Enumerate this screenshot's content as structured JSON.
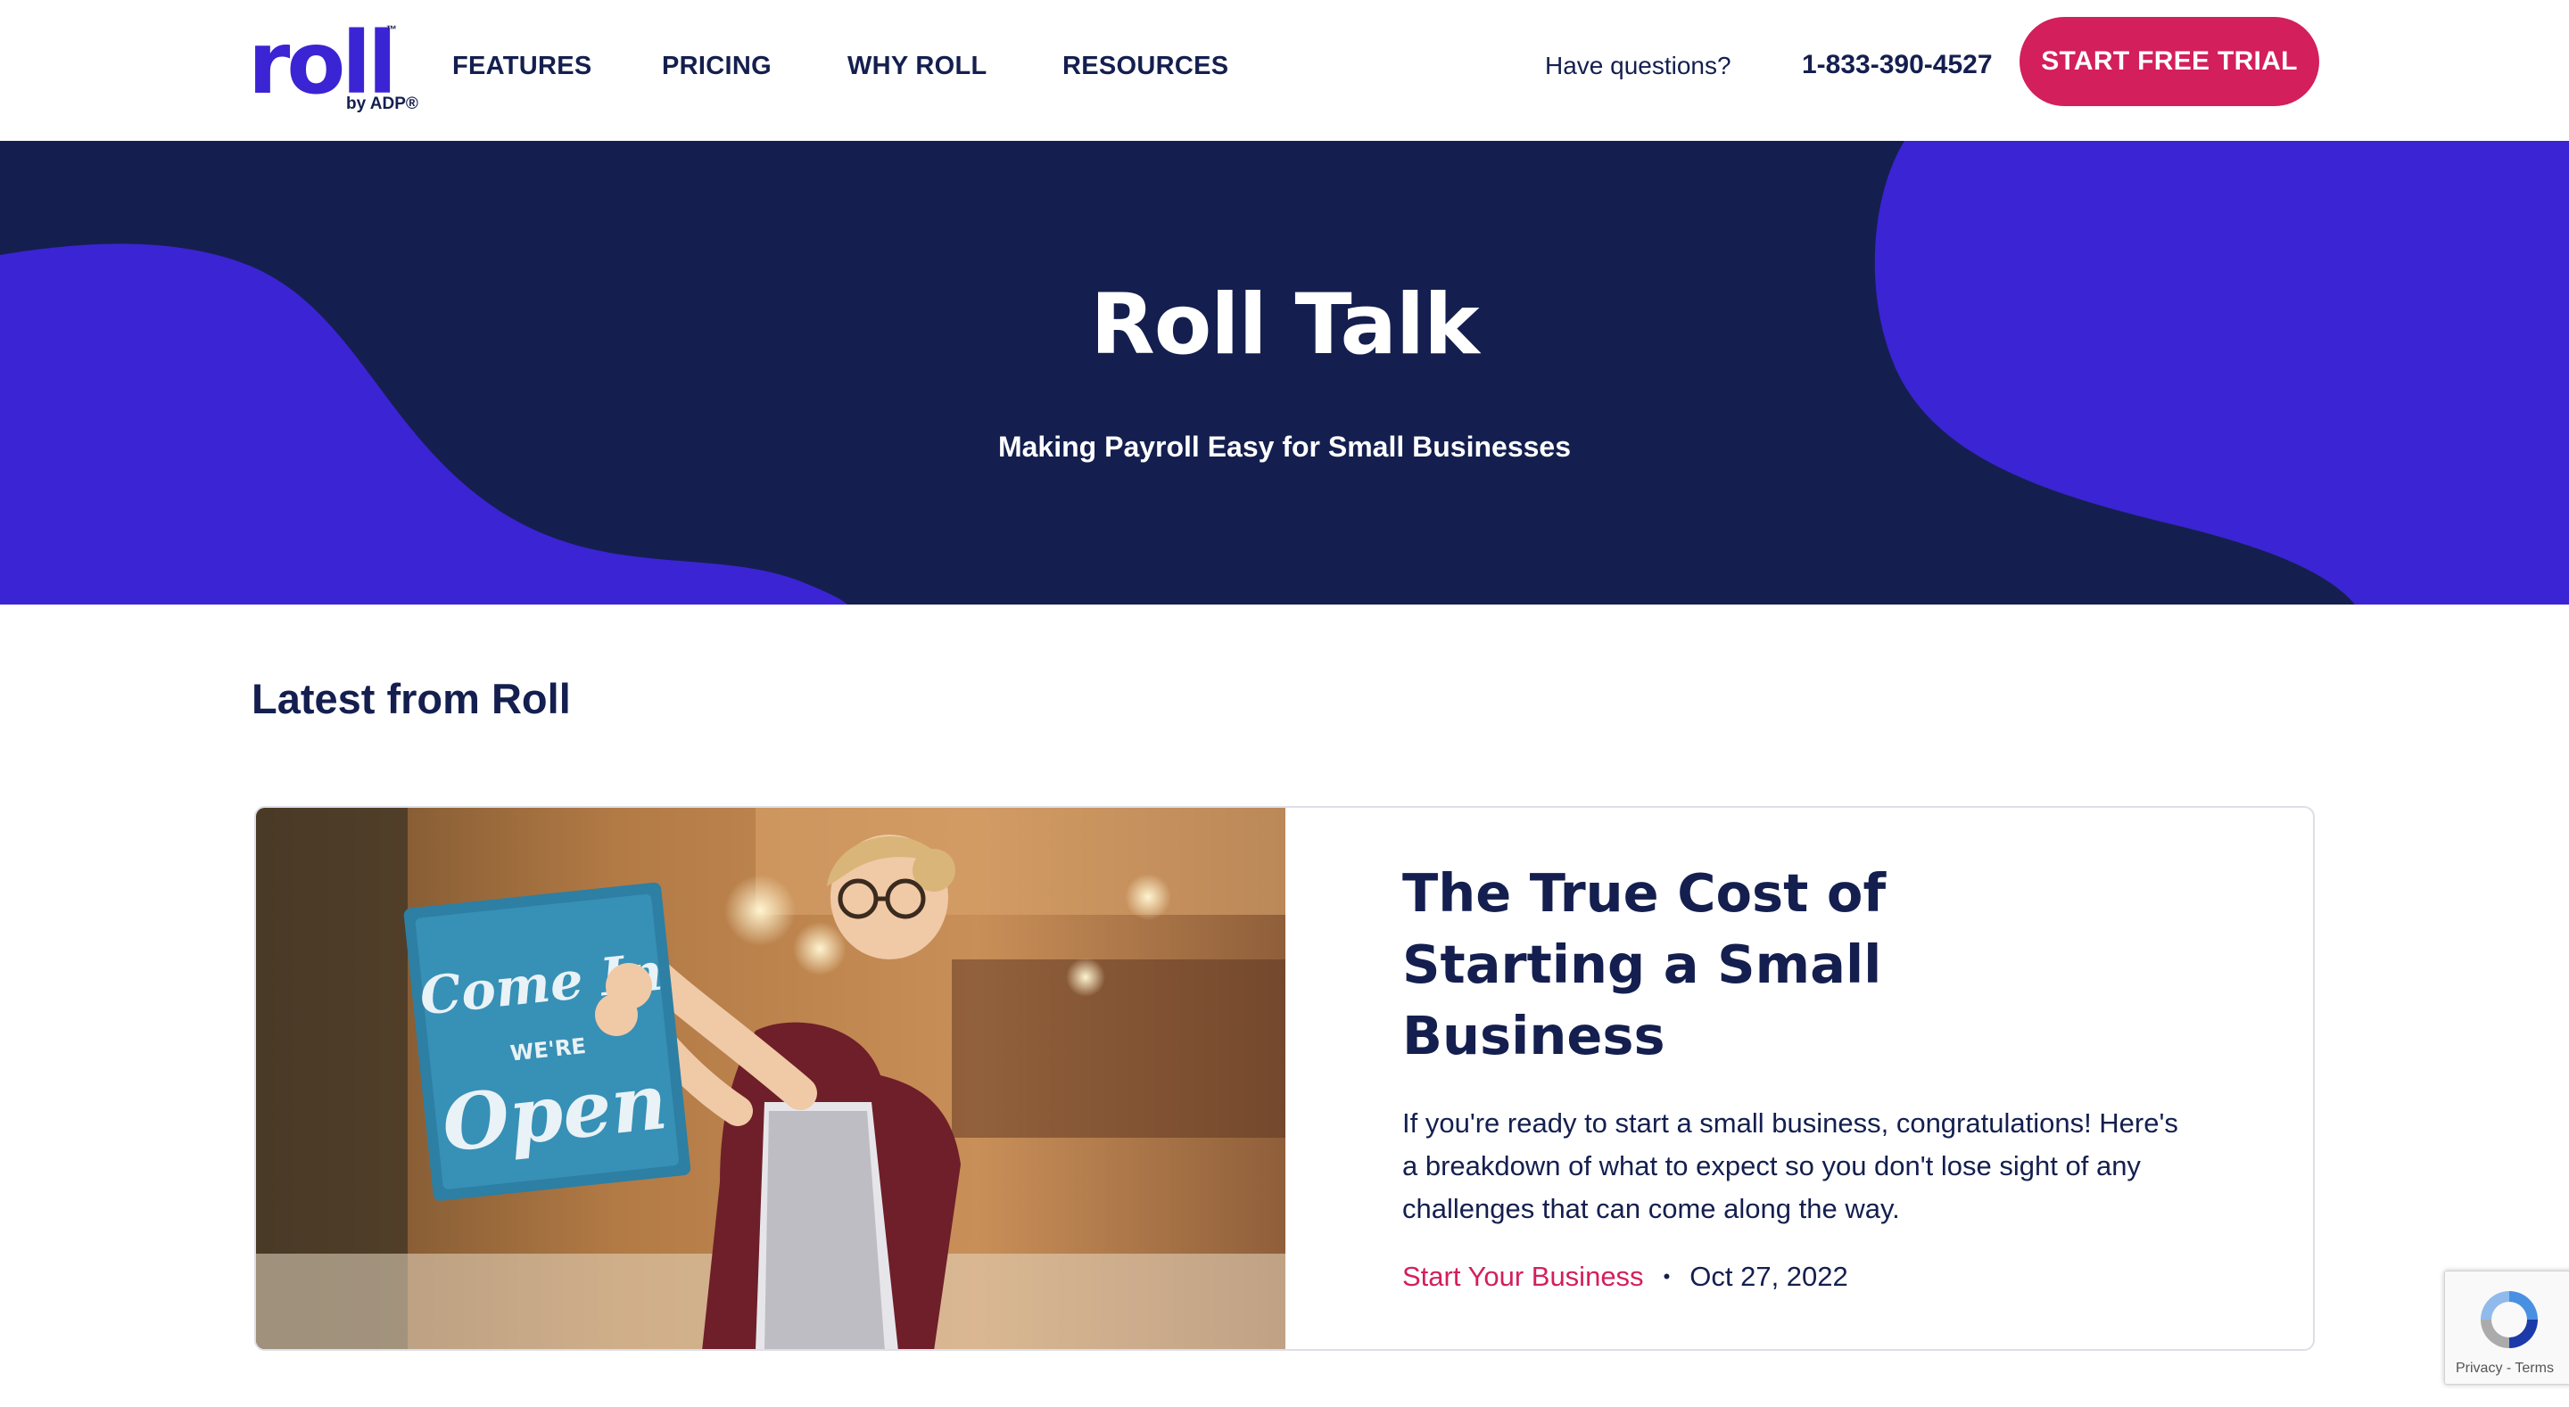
{
  "header": {
    "logo_word": "roll",
    "logo_tm": "™",
    "logo_sub": "by ADP®",
    "nav": [
      "FEATURES",
      "PRICING",
      "WHY ROLL",
      "RESOURCES"
    ],
    "questions_text": "Have questions?",
    "phone": "1-833-390-4527",
    "cta_label": "START FREE TRIAL"
  },
  "hero": {
    "title": "Roll Talk",
    "subtitle": "Making Payroll Easy for Small Businesses"
  },
  "latest": {
    "heading": "Latest from Roll",
    "article": {
      "title": "The True Cost of Starting a Small Business",
      "excerpt": "If you're ready to start a small business, congratulations! Here's a breakdown of what to expect so you don't lose sight of any challenges that can come along the way.",
      "category": "Start Your Business",
      "separator": "•",
      "date": "Oct 27, 2022",
      "sign_lines": [
        "Come In",
        "WE'RE",
        "Open"
      ]
    }
  },
  "recaptcha": {
    "privacy": "Privacy",
    "sep": " - ",
    "terms": "Terms"
  },
  "colors": {
    "brand_purple": "#3b24d3",
    "navy": "#141f4f",
    "accent_pink": "#d31f5b"
  }
}
